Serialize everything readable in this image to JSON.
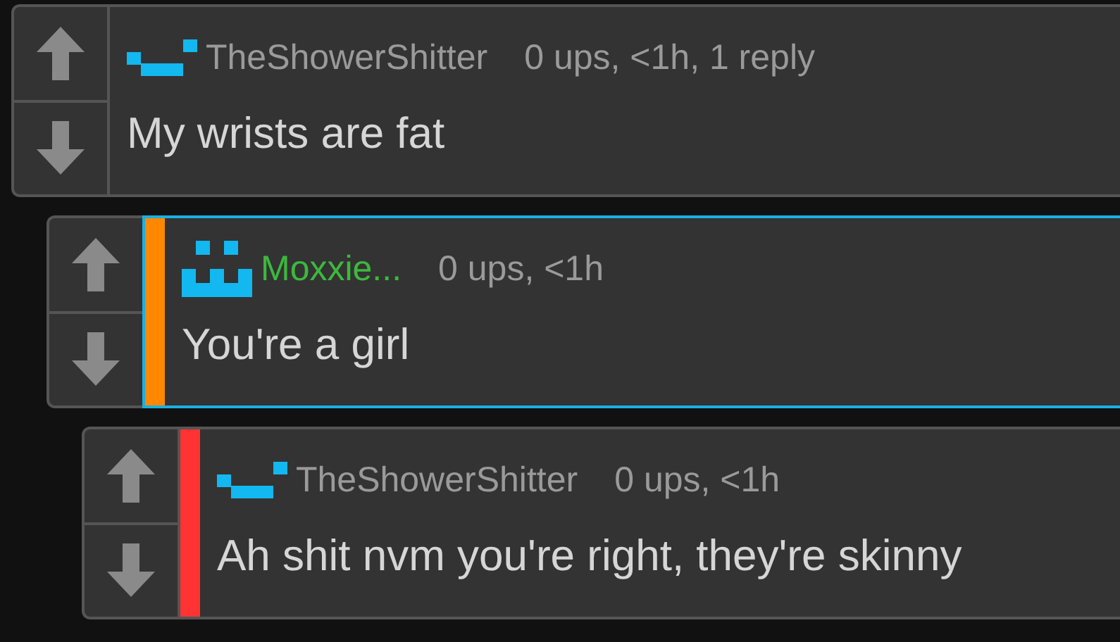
{
  "comments": [
    {
      "username": {
        "text": "TheShowerShitter",
        "color": "#9a9a9a"
      },
      "avatar": {
        "kind": "dash"
      },
      "meta": "0 ups, <1h, 1 reply",
      "text": "My wrists are fat",
      "highlighted": false,
      "children": [
        {
          "username": {
            "text": "Moxxie...",
            "color": "#3db83d"
          },
          "avatar": {
            "kind": "face"
          },
          "meta": "0 ups, <1h",
          "text": "You're a girl",
          "highlighted": true,
          "bar": {
            "color": "#ff8800"
          },
          "children": [
            {
              "username": {
                "text": "TheShowerShitter",
                "color": "#9a9a9a"
              },
              "avatar": {
                "kind": "dash"
              },
              "meta": "0 ups, <1h",
              "text": "Ah shit nvm you're right, they're skinny",
              "highlighted": false,
              "bar": {
                "color": "#ff3333"
              }
            }
          ]
        }
      ]
    }
  ]
}
